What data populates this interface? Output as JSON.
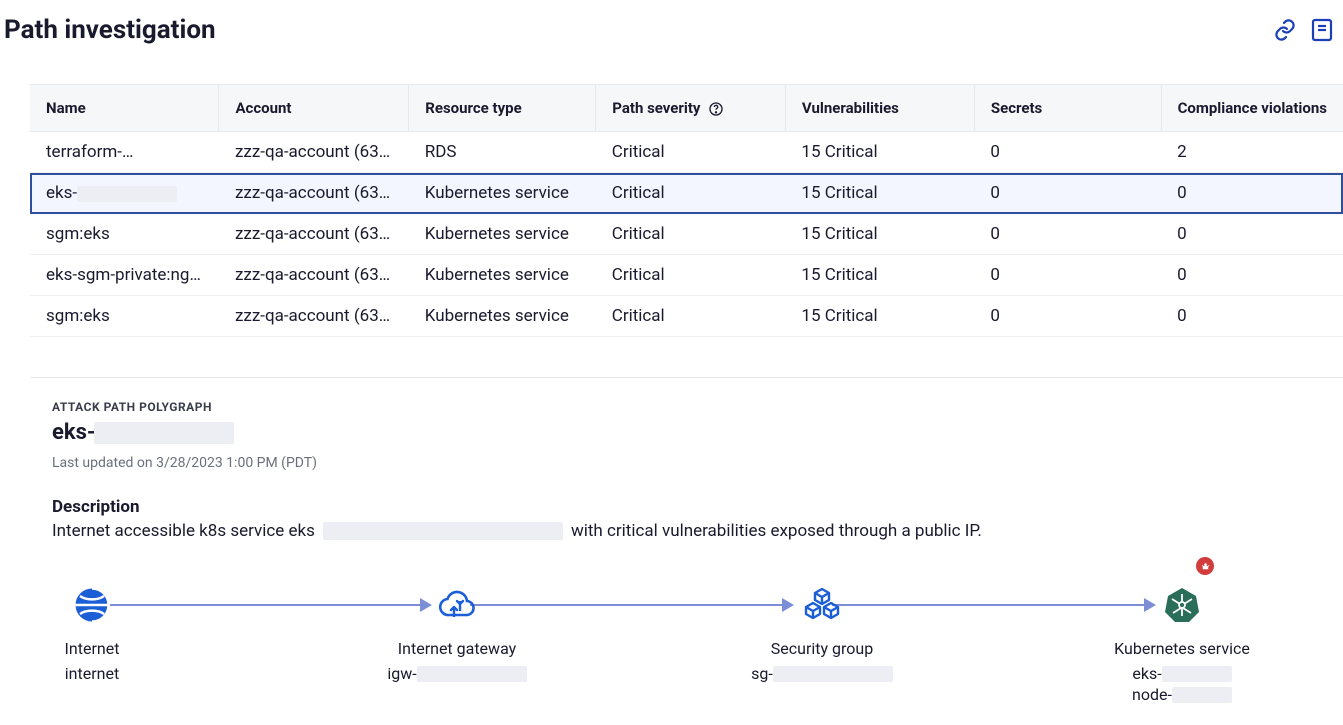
{
  "page": {
    "title": "Path investigation"
  },
  "table": {
    "headers": {
      "name": "Name",
      "account": "Account",
      "resource_type": "Resource type",
      "path_severity": "Path severity",
      "vulnerabilities": "Vulnerabilities",
      "secrets": "Secrets",
      "compliance": "Compliance violations"
    },
    "rows": [
      {
        "name": "terraform-",
        "name_redacted": true,
        "account": "zzz-qa-account (63…",
        "resource_type": "RDS",
        "severity": "Critical",
        "vulnerabilities": "15 Critical",
        "secrets": "0",
        "compliance": "2",
        "selected": false
      },
      {
        "name": "eks-",
        "name_redacted": true,
        "account": "zzz-qa-account (63…",
        "resource_type": "Kubernetes service",
        "severity": "Critical",
        "vulnerabilities": "15 Critical",
        "secrets": "0",
        "compliance": "0",
        "selected": true
      },
      {
        "name": "sgm:eks",
        "name_redacted": false,
        "account": "zzz-qa-account (63…",
        "resource_type": "Kubernetes service",
        "severity": "Critical",
        "vulnerabilities": "15 Critical",
        "secrets": "0",
        "compliance": "0",
        "selected": false
      },
      {
        "name": "eks-sgm-private:ngi…",
        "name_redacted": false,
        "account": "zzz-qa-account (63…",
        "resource_type": "Kubernetes service",
        "severity": "Critical",
        "vulnerabilities": "15 Critical",
        "secrets": "0",
        "compliance": "0",
        "selected": false
      },
      {
        "name": "sgm:eks",
        "name_redacted": false,
        "account": "zzz-qa-account (63…",
        "resource_type": "Kubernetes service",
        "severity": "Critical",
        "vulnerabilities": "15 Critical",
        "secrets": "0",
        "compliance": "0",
        "selected": false
      }
    ]
  },
  "panel": {
    "label": "ATTACK PATH POLYGRAPH",
    "title_prefix": "eks-",
    "last_updated": "Last updated on 3/28/2023 1:00 PM (PDT)",
    "description_heading": "Description",
    "description_pre": "Internet accessible k8s service eks",
    "description_post": "with critical vulnerabilities exposed through a public IP."
  },
  "graph": {
    "nodes": [
      {
        "type": "Internet",
        "sub": "internet",
        "sub_redacted": false
      },
      {
        "type": "Internet gateway",
        "sub": "igw-",
        "sub_redacted": true
      },
      {
        "type": "Security group",
        "sub": "sg-",
        "sub_redacted": true
      },
      {
        "type": "Kubernetes service",
        "sub": "eks-",
        "sub2": "node-",
        "sub_redacted": true
      }
    ]
  }
}
